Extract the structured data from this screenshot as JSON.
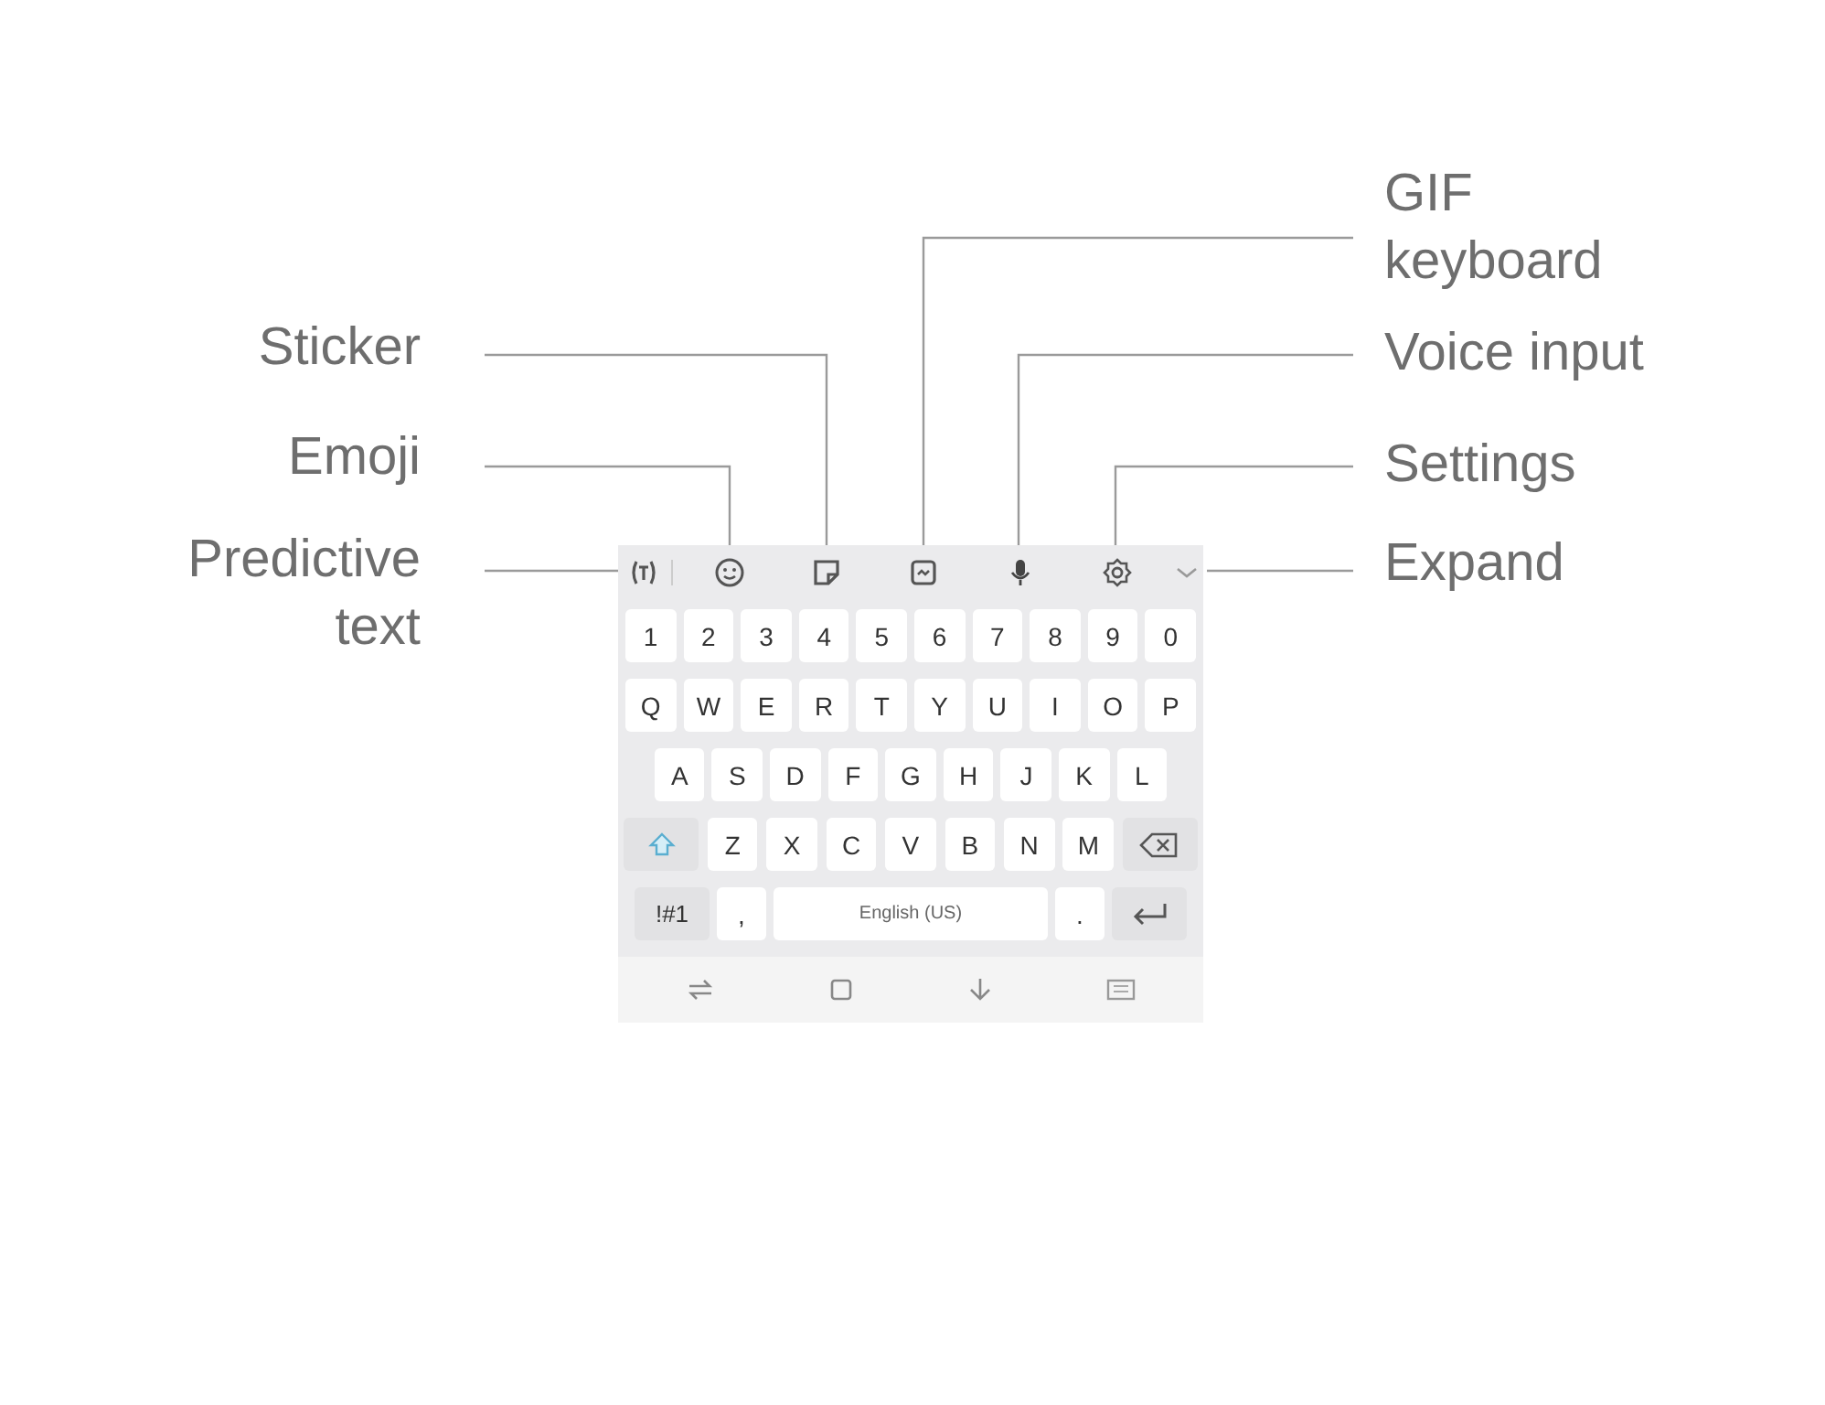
{
  "left_callouts": [
    {
      "text": "Sticker"
    },
    {
      "text": "Emoji"
    },
    {
      "text": "Predictive\ntext"
    }
  ],
  "right_callouts": [
    {
      "text": "GIF\nkeyboard"
    },
    {
      "text": "Voice input"
    },
    {
      "text": "Settings"
    },
    {
      "text": "Expand"
    }
  ],
  "keyboard": {
    "number_row": [
      "1",
      "2",
      "3",
      "4",
      "5",
      "6",
      "7",
      "8",
      "9",
      "0"
    ],
    "letter_rows": [
      [
        "Q",
        "W",
        "E",
        "R",
        "T",
        "Y",
        "U",
        "I",
        "O",
        "P"
      ],
      [
        "A",
        "S",
        "D",
        "F",
        "G",
        "H",
        "J",
        "K",
        "L"
      ],
      [
        "Z",
        "X",
        "C",
        "V",
        "B",
        "N",
        "M"
      ]
    ],
    "symbols_key": "!#1",
    "comma_key": ",",
    "space_key": "English (US)",
    "period_key": "."
  }
}
